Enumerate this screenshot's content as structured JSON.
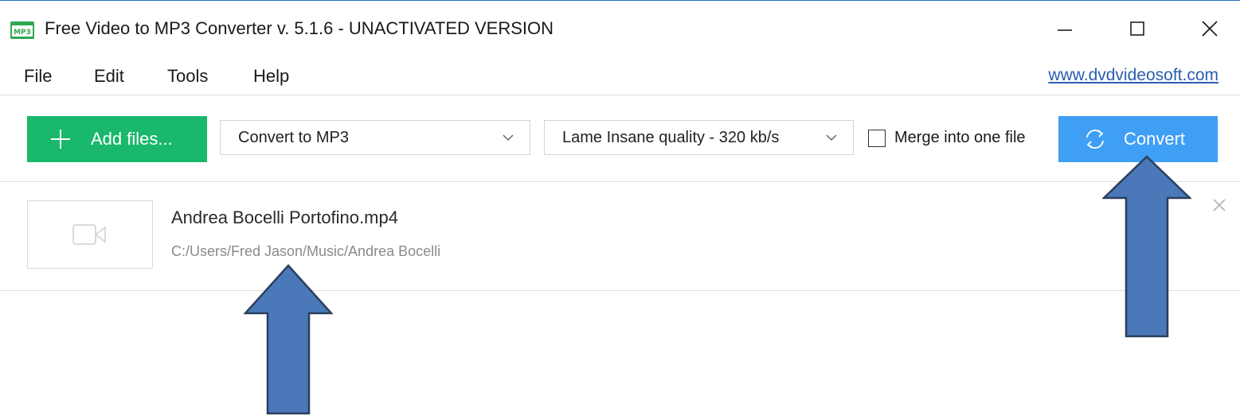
{
  "window": {
    "title": "Free Video to MP3 Converter v. 5.1.6 - UNACTIVATED VERSION",
    "app_icon_label": "MP3",
    "controls": [
      "minimize-icon",
      "maximize-icon",
      "close-icon"
    ]
  },
  "menu": {
    "items": [
      "File",
      "Edit",
      "Tools",
      "Help"
    ],
    "website_link": "www.dvdvideosoft.com"
  },
  "toolbar": {
    "add_files_label": "Add files...",
    "format_selected": "Convert to MP3",
    "quality_selected": "Lame Insane quality - 320 kb/s",
    "merge_label": "Merge into one file",
    "merge_checked": false,
    "convert_label": "Convert"
  },
  "files": [
    {
      "name": "Andrea Bocelli Portofino.mp4",
      "path": "C:/Users/Fred Jason/Music/Andrea Bocelli",
      "thumbnail_icon": "video-camera-icon"
    }
  ],
  "annotations": [
    {
      "name": "annotation-arrow-file",
      "points_to": "file-name",
      "color": "#4a78b8"
    },
    {
      "name": "annotation-arrow-convert",
      "points_to": "convert-button",
      "color": "#4a78b8"
    }
  ],
  "colors": {
    "add_button": "#19b86c",
    "convert_button": "#3f9ff5",
    "link": "#2a5db0",
    "arrow_fill": "#4a78b8",
    "arrow_stroke": "#2a3f5c"
  }
}
